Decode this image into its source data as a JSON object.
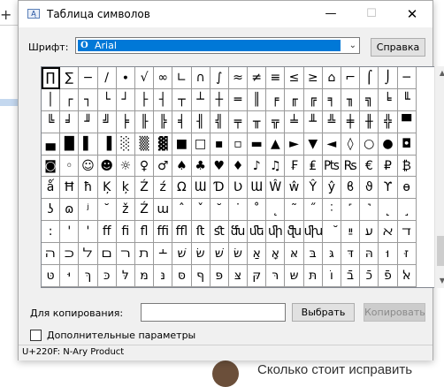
{
  "background": {
    "plus_glyph": "+",
    "article_title": "Сколько стоит исправить"
  },
  "window": {
    "title": "Таблица символов",
    "minimize": "—",
    "maximize": "☐",
    "close": "✕"
  },
  "font_row": {
    "label": "Шрифт:",
    "selected_font": "Arial",
    "font_icon": "O",
    "help_button": "Справка"
  },
  "grid": {
    "columns": 20,
    "selected_index": 0,
    "rows": [
      [
        "∏",
        "∑",
        "−",
        "∕",
        "∙",
        "√",
        "∞",
        "∟",
        "∩",
        "∫",
        "≈",
        "≠",
        "≡",
        "≤",
        "≥",
        "⌂",
        "⌐",
        "⌠",
        "⌡",
        "─"
      ],
      [
        "│",
        "┌",
        "┐",
        "└",
        "┘",
        "├",
        "┤",
        "┬",
        "┴",
        "┼",
        "═",
        "║",
        "╒",
        "╓",
        "╔",
        "╕",
        "╖",
        "╗",
        "╘",
        "╙"
      ],
      [
        "╚",
        "╛",
        "╜",
        "╝",
        "╞",
        "╟",
        "╠",
        "╡",
        "╢",
        "╣",
        "╤",
        "╥",
        "╦",
        "╧",
        "╨",
        "╩",
        "╪",
        "╫",
        "╬",
        "▀"
      ],
      [
        "▄",
        "█",
        "▌",
        "▐",
        "░",
        "▒",
        "▓",
        "■",
        "□",
        "▪",
        "▫",
        "▬",
        "▲",
        "►",
        "▼",
        "◄",
        "◊",
        "○",
        "●",
        "◘"
      ],
      [
        "◙",
        "◦",
        "☺",
        "☻",
        "☼",
        "♀",
        "♂",
        "♠",
        "♣",
        "♥",
        "♦",
        "♪",
        "♫",
        "₣",
        "₤",
        "₧",
        "₨",
        "€",
        "₽",
        "₿"
      ],
      [
        "ǻ",
        "Ħ",
        "ħ",
        "Ķ",
        "ķ",
        "Ź",
        "ź",
        "Ω",
        "Ɯ",
        "Ɗ",
        "Ʋ",
        "Ɯ",
        "Ŵ",
        "ŵ",
        "Ŷ",
        "ŷ",
        "ϐ",
        "ϑ",
        "ϒ",
        "ɵ"
      ],
      [
        "ʖ",
        "ɷ",
        "ʲ",
        "˘",
        "ž",
        "Ź",
        "ɯ",
        "ˆ",
        "ˇ",
        "˘",
        "˙",
        "˚",
        "˛",
        "˜",
        "˝",
        "˸",
        "˹",
        "˺",
        "˻",
        "˼"
      ],
      [
        ":",
        "'",
        "'",
        "ﬀ",
        "ﬁ",
        "ﬂ",
        "ﬃ",
        "ﬄ",
        "ﬅ",
        "ﬆ",
        "ﬓ",
        "ﬔ",
        "ﬕ",
        "ﬖ",
        "ﬗ",
        "ﬞ",
        "ײַ",
        "ﬠ",
        "ﬡ",
        "ﬢ"
      ],
      [
        "ﬣ",
        "ﬤ",
        "ﬥ",
        "ﬦ",
        "ﬧ",
        "ﬨ",
        "﬩",
        "שׁ",
        "שׂ",
        "שּׁ",
        "שּׂ",
        "אַ",
        "אָ",
        "אּ",
        "בּ",
        "גּ",
        "דּ",
        "הּ",
        "וּ",
        "זּ"
      ],
      [
        "טּ",
        "יּ",
        "ךּ",
        "כּ",
        "לּ",
        "מּ",
        "נּ",
        "סּ",
        "ףּ",
        "פּ",
        "צּ",
        "קּ",
        "רּ",
        "שּ",
        "תּ",
        "וֹ",
        "בֿ",
        "כֿ",
        "פֿ",
        "ﭏ"
      ]
    ]
  },
  "copy_row": {
    "label": "Для копирования:",
    "value": "",
    "select_button": "Выбрать",
    "copy_button": "Копировать"
  },
  "advanced": {
    "label": "Дополнительные параметры",
    "checked": false
  },
  "status": {
    "text": "U+220F: N-Ary Product"
  },
  "scrollbar": {
    "up_arrow": "▲",
    "down_arrow": "▼"
  }
}
